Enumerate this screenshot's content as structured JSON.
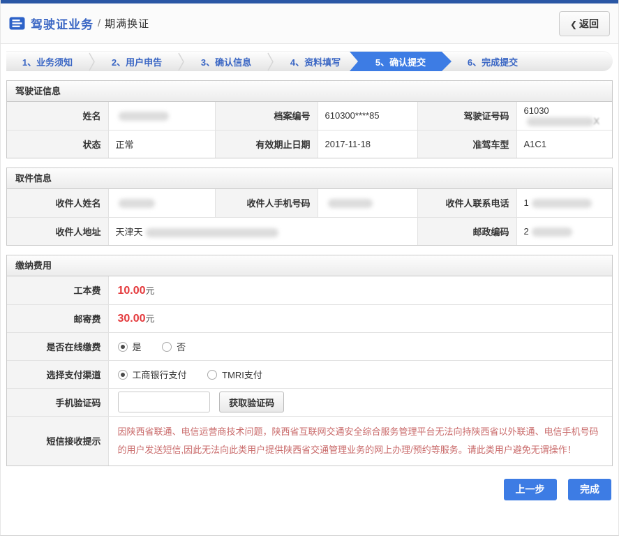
{
  "header": {
    "breadcrumb_section": "驾驶证业务",
    "breadcrumb_separator": "/",
    "breadcrumb_current": "期满换证",
    "back_chevron": "❮",
    "back_label": "返回"
  },
  "steps": {
    "active_index": 4,
    "items": [
      {
        "label": "1、业务须知"
      },
      {
        "label": "2、用户申告"
      },
      {
        "label": "3、确认信息"
      },
      {
        "label": "4、资料填写"
      },
      {
        "label": "5、确认提交"
      },
      {
        "label": "6、完成提交"
      }
    ]
  },
  "license_section": {
    "title": "驾驶证信息",
    "name_label": "姓名",
    "file_no_label": "档案编号",
    "file_no_value": "610300****85",
    "license_no_label": "驾驶证号码",
    "license_no_prefix": "61030",
    "license_no_suffix": "X",
    "status_label": "状态",
    "status_value": "正常",
    "expiry_label": "有效期止日期",
    "expiry_value": "2017-11-18",
    "vehicle_label": "准驾车型",
    "vehicle_value": "A1C1"
  },
  "pickup_section": {
    "title": "取件信息",
    "recipient_name_label": "收件人姓名",
    "recipient_mobile_label": "收件人手机号码",
    "recipient_phone_label": "收件人联系电话",
    "recipient_phone_prefix": "1",
    "recipient_address_label": "收件人地址",
    "recipient_address_prefix": "天津天",
    "postcode_label": "邮政编码",
    "postcode_prefix": "2"
  },
  "payment_section": {
    "title": "缴纳费用",
    "work_fee_label": "工本费",
    "work_fee_value": "10.00",
    "work_fee_unit": "元",
    "post_fee_label": "邮寄费",
    "post_fee_value": "30.00",
    "post_fee_unit": "元",
    "online_pay_label": "是否在线缴费",
    "online_pay_yes": "是",
    "online_pay_no": "否",
    "online_pay_selected": "是",
    "channel_label": "选择支付渠道",
    "channel_icbc": "工商银行支付",
    "channel_tmri": "TMRI支付",
    "channel_selected": "工商银行支付",
    "sms_code_label": "手机验证码",
    "sms_code_value": "",
    "get_code_button": "获取验证码",
    "sms_tip_label": "短信接收提示",
    "sms_tip_text": "因陕西省联通、电信运营商技术问题，陕西省互联网交通安全综合服务管理平台无法向持陕西省以外联通、电信手机号码的用户发送短信,因此无法向此类用户提供陕西省交通管理业务的网上办理/预约等服务。请此类用户避免无谓操作！"
  },
  "footer": {
    "prev_button": "上一步",
    "finish_button": "完成"
  },
  "colors": {
    "accent_blue": "#3d7ce4",
    "topbar_blue": "#2a57a5",
    "link_blue": "#3a66c4",
    "fee_red": "#e4393c",
    "tip_red": "#c96a6a"
  }
}
